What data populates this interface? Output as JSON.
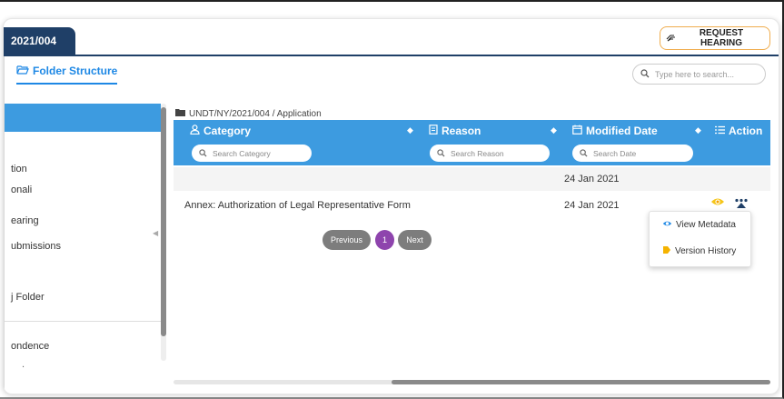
{
  "case_tab": {
    "label": "2021/004"
  },
  "header": {
    "request_hearing_label": "REQUEST HEARING"
  },
  "tabs": {
    "folder_structure": "Folder Structure"
  },
  "search": {
    "placeholder": "Type here to search..."
  },
  "sidebar": {
    "items": [
      {
        "label": "tion"
      },
      {
        "label": "onali"
      },
      {
        "label": "earing"
      },
      {
        "label": "ubmissions"
      },
      {
        "label": "j Folder"
      },
      {
        "label": "ondence"
      },
      {
        "label": "ents"
      }
    ]
  },
  "breadcrumb": {
    "path": "UNDT/NY/2021/004 / Application"
  },
  "table": {
    "columns": [
      {
        "label": "Category",
        "filter_placeholder": "Search Category"
      },
      {
        "label": "Reason",
        "filter_placeholder": "Search Reason"
      },
      {
        "label": "Modified Date",
        "filter_placeholder": "Search Date"
      },
      {
        "label": "Action"
      }
    ],
    "rows": [
      {
        "category": "",
        "reason": "",
        "modified": "24 Jan 2021"
      },
      {
        "category": "Annex: Authorization of Legal Representative Form",
        "reason": "",
        "modified": "24 Jan 2021"
      }
    ]
  },
  "pagination": {
    "previous": "Previous",
    "current": "1",
    "next": "Next"
  },
  "action_menu": {
    "view_metadata": "View Metadata",
    "version_history": "Version History"
  },
  "colors": {
    "brand_dark": "#1f3f67",
    "header_blue": "#3d9be0",
    "link_blue": "#1e88e5",
    "accent_orange": "#f0ad4e",
    "page_purple": "#8e44ad"
  },
  "icons": {
    "request": "hand-icon",
    "folder": "folder-open-icon",
    "search": "search-icon",
    "category": "user-icon",
    "reason": "document-icon",
    "date": "calendar-icon",
    "action": "list-icon",
    "view": "eye-icon",
    "more": "more-icon"
  }
}
